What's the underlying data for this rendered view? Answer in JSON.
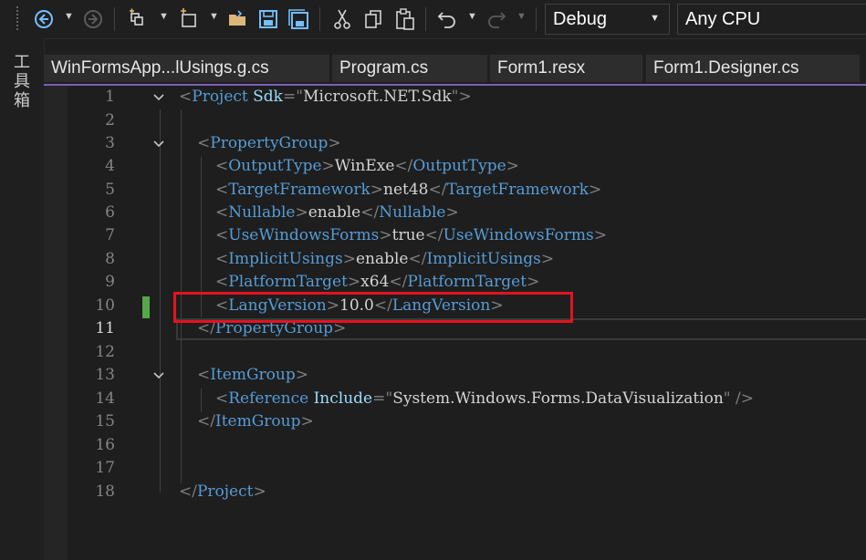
{
  "toolbar": {
    "icons": [
      "back-icon",
      "forward-icon",
      "new-project-icon",
      "new-item-icon",
      "open-folder-icon",
      "save-icon",
      "save-all-icon",
      "cut-icon",
      "copy-icon",
      "paste-icon",
      "undo-icon",
      "redo-icon"
    ],
    "configuration": "Debug",
    "platform": "Any CPU"
  },
  "toolbox": {
    "label": "工具箱"
  },
  "tabs": [
    {
      "label": "WinFormsApp...lUsings.g.cs"
    },
    {
      "label": "Program.cs"
    },
    {
      "label": "Form1.resx"
    },
    {
      "label": "Form1.Designer.cs"
    }
  ],
  "editor": {
    "line_numbers": [
      "1",
      "2",
      "3",
      "4",
      "5",
      "6",
      "7",
      "8",
      "9",
      "10",
      "11",
      "12",
      "13",
      "14",
      "15",
      "16",
      "17",
      "18"
    ],
    "active_line": "11",
    "line1": {
      "tag": "Project",
      "attr": "Sdk",
      "value": "Microsoft.NET.Sdk"
    },
    "line3": {
      "tag": "PropertyGroup"
    },
    "line4": {
      "tag": "OutputType",
      "text": "WinExe"
    },
    "line5": {
      "tag": "TargetFramework",
      "text": "net48"
    },
    "line6": {
      "tag": "Nullable",
      "text": "enable"
    },
    "line7": {
      "tag": "UseWindowsForms",
      "text": "true"
    },
    "line8": {
      "tag": "ImplicitUsings",
      "text": "enable"
    },
    "line9": {
      "tag": "PlatformTarget",
      "text": "x64"
    },
    "line10": {
      "tag": "LangVersion",
      "text": "10.0"
    },
    "line11": {
      "tag": "PropertyGroup"
    },
    "line13": {
      "tag": "ItemGroup"
    },
    "line14": {
      "tag": "Reference",
      "attr": "Include",
      "value": "System.Windows.Forms.DataVisualization"
    },
    "line15": {
      "tag": "ItemGroup"
    },
    "line18": {
      "tag": "Project"
    }
  },
  "colors": {
    "highlight_box": "#e3131f",
    "change_marker": "#57a64a",
    "xml_tag": "#569cd6",
    "xml_attribute": "#9cdcfe",
    "tab_underline": "#7b5fb8"
  }
}
